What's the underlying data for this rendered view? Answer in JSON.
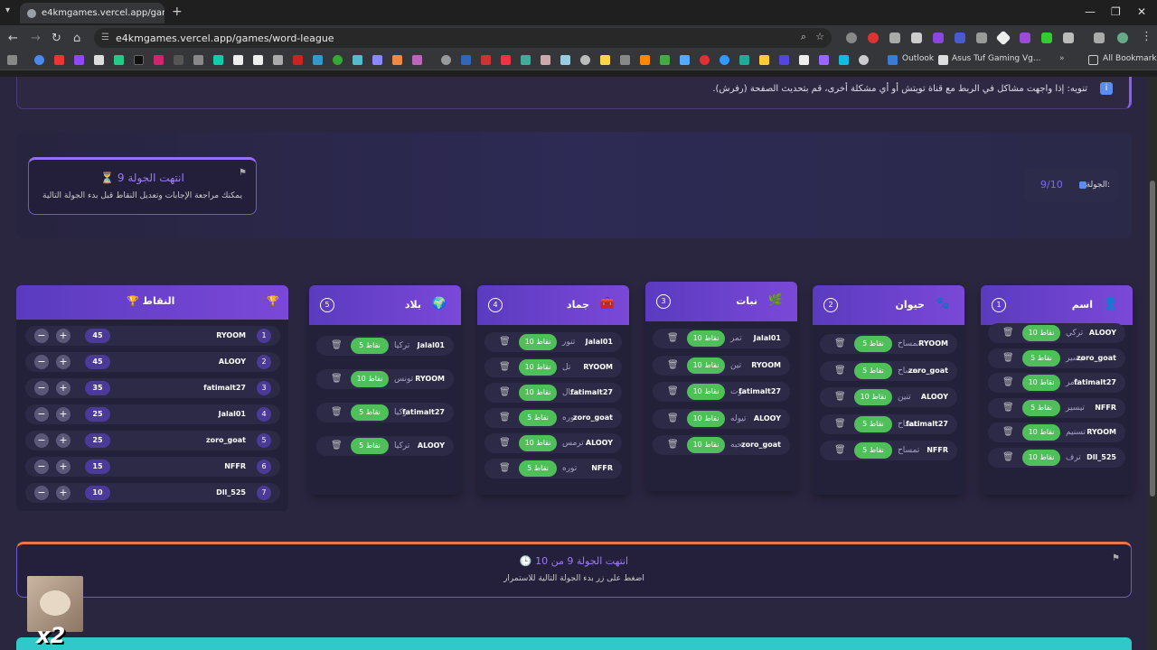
{
  "browser": {
    "tab_title": "e4kmgames.vercel.app/games/w",
    "url": "e4kmgames.vercel.app/games/word-league",
    "bookmarks": [
      "Outlook",
      "Asus Tuf Gaming Vg..."
    ],
    "all_bookmarks": "All Bookmarks"
  },
  "notice": {
    "text": "تنويه: إذا واجهت مشاكل في الربط مع قناة تويتش أو أي مشكلة أخرى، قم بتحديث الصفحة (رفرش)."
  },
  "round": {
    "ended_title": "⏳ انتهت الجولة 9",
    "ended_sub": "يمكنك مراجعة الإجابات وتعديل النقاط قبل بدء الجولة التالية",
    "label": "الجولة:",
    "value": "9/10"
  },
  "scores": {
    "title": "النقاط",
    "rows": [
      {
        "rank": "1",
        "name": "RYOOM",
        "score": "45"
      },
      {
        "rank": "2",
        "name": "ALOOY",
        "score": "45"
      },
      {
        "rank": "3",
        "name": "fatimalt27",
        "score": "35"
      },
      {
        "rank": "4",
        "name": "Jalal01",
        "score": "25"
      },
      {
        "rank": "5",
        "name": "zoro_goat",
        "score": "25"
      },
      {
        "rank": "6",
        "name": "NFFR",
        "score": "15"
      },
      {
        "rank": "7",
        "name": "Dll_525",
        "score": "10"
      }
    ]
  },
  "categories": [
    {
      "num": "5",
      "title": "بلاد",
      "emoji": "🌍",
      "answers": [
        {
          "player": "Jalal01",
          "word": "تركيا",
          "pts": "5 نقاط"
        },
        {
          "player": "RYOOM",
          "word": "تونس",
          "pts": "10 نقاط"
        },
        {
          "player": "fatimalt27",
          "word": "تركيا",
          "pts": "5 نقاط"
        },
        {
          "player": "ALOOY",
          "word": "تركيا",
          "pts": "5 نقاط"
        }
      ]
    },
    {
      "num": "4",
      "title": "جماد",
      "emoji": "🧰",
      "answers": [
        {
          "player": "Jalal01",
          "word": "تنور",
          "pts": "10 نقاط"
        },
        {
          "player": "RYOOM",
          "word": "تل",
          "pts": "10 نقاط"
        },
        {
          "player": "fatimalt27",
          "word": "تمثال",
          "pts": "10 نقاط"
        },
        {
          "player": "zoro_goat",
          "word": "توره",
          "pts": "5 نقاط"
        },
        {
          "player": "ALOOY",
          "word": "ترمس",
          "pts": "10 نقاط"
        },
        {
          "player": "NFFR",
          "word": "توره",
          "pts": "5 نقاط"
        }
      ]
    },
    {
      "num": "3",
      "title": "نبات",
      "emoji": "🌿",
      "answers": [
        {
          "player": "Jalal01",
          "word": "تمر",
          "pts": "10 نقاط"
        },
        {
          "player": "RYOOM",
          "word": "تين",
          "pts": "10 نقاط"
        },
        {
          "player": "fatimalt27",
          "word": "توت",
          "pts": "10 نقاط"
        },
        {
          "player": "ALOOY",
          "word": "تيوله",
          "pts": "10 نقاط"
        },
        {
          "player": "zoro_goat",
          "word": "يحبه",
          "pts": "10 نقاط"
        }
      ]
    },
    {
      "num": "2",
      "title": "حيوان",
      "emoji": "🐾",
      "answers": [
        {
          "player": "RYOOM",
          "word": "تمساح",
          "pts": "5 نقاط"
        },
        {
          "player": "zoro_goat",
          "word": "تمساح",
          "pts": "5 نقاط"
        },
        {
          "player": "ALOOY",
          "word": "تنين",
          "pts": "10 نقاط"
        },
        {
          "player": "fatimalt27",
          "word": "تمساح",
          "pts": "5 نقاط"
        },
        {
          "player": "NFFR",
          "word": "تمساح",
          "pts": "5 نقاط"
        }
      ]
    },
    {
      "num": "1",
      "title": "اسم",
      "emoji": "👤",
      "answers": [
        {
          "player": "ALOOY",
          "word": "تركي",
          "pts": "10 نقاط"
        },
        {
          "player": "zoro_goat",
          "word": "تيسير",
          "pts": "5 نقاط"
        },
        {
          "player": "fatimalt27",
          "word": "تامر",
          "pts": "10 نقاط"
        },
        {
          "player": "NFFR",
          "word": "تيسير",
          "pts": "5 نقاط"
        },
        {
          "player": "RYOOM",
          "word": "تسنيم",
          "pts": "10 نقاط"
        },
        {
          "player": "Dll_525",
          "word": "ترف",
          "pts": "10 نقاط"
        }
      ]
    }
  ],
  "footer": {
    "title": "🕒 انتهت الجولة 9 من 10",
    "sub": "اضغط على زر بدء الجولة التالية للاستمرار"
  },
  "overlay": {
    "badge": "x2"
  }
}
